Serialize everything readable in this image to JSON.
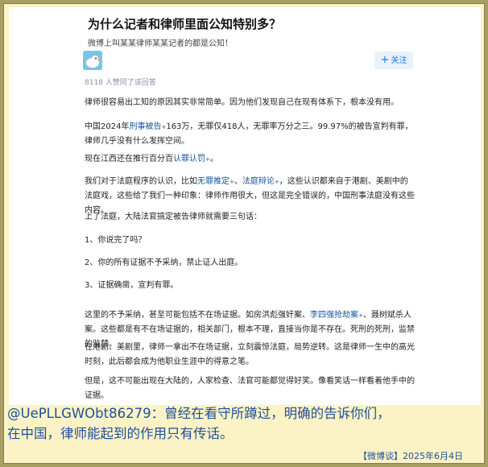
{
  "question": {
    "title": "为什么记者和律师里面公知特别多？",
    "subtitle": "微博上叫某某律师某某记者的都是公知！"
  },
  "author": {
    "follow_label": "关注",
    "upvote_text": "8118 人赞同了该回答"
  },
  "answer": {
    "p1": "律师很容易出工知的原因其实非常简单。因为他们发现自己在现有体系下，根本没有用。",
    "p2_a": "中国2024年",
    "p2_link": "刑事被告",
    "p2_b": "163万，无罪仅418人，无罪率万分之三。99.97%的被告宣判有罪，律师几乎没有什么发挥空间。",
    "p3_a": "现在江西还在推行百分百",
    "p3_link": "认罪认罚",
    "p3_b": "。",
    "p4_a": "我们对于法庭程序的认识，比如",
    "p4_link1": "无罪推定",
    "p4_sep": "、",
    "p4_link2": "法庭辩论",
    "p4_b": "，这些认识都来自于港剧、美剧中的法庭戏，这些给了我们一种印象：律师作用很大，但这是完全错误的，中国刑事法庭没有这些内容。",
    "p5": "上了法庭，大陆法官搞定被告律师就需要三句话：",
    "p6": "1、你说完了吗？",
    "p7": "2、你的所有证据不予采纳，禁止证人出庭。",
    "p8": "3、证据确凿，宣判有罪。",
    "p9_a": "这里的不予采纳，甚至可能包括不在场证据。如房洪彪强奸案、",
    "p9_link": "李四强抢劫案",
    "p9_b": "、聂树斌杀人案。这些都是有不在场证据的，相关部门，根本不理，直接当你是不存在。死刑的死刑，监禁的监禁。",
    "p10": "在港剧、美剧里，律师一拿出不在场证据，立刻震惊法庭，局势逆转。这是律师一生中的高光时刻，此后都会成为他职业生涯中的得意之笔。",
    "p11": "但是，这不可能出现在大陆的，人家检查、法官可能都觉得好笑。像看笑话一样看着他手中的证据。",
    "star": "+"
  },
  "quote": {
    "line1": "@UePLLGWObt86279：曾经在看守所蹲过，明确的告诉你们，",
    "line2": "在中国，律师能起到的作用只有传话。"
  },
  "footer": "【微博谈】2025年6月4日",
  "colors": {
    "link": "#175199",
    "follow": "#1772f6",
    "quote": "#1f4f9c",
    "frame_bg": "#fbf3c6",
    "outer_bg": "#a89e63"
  }
}
